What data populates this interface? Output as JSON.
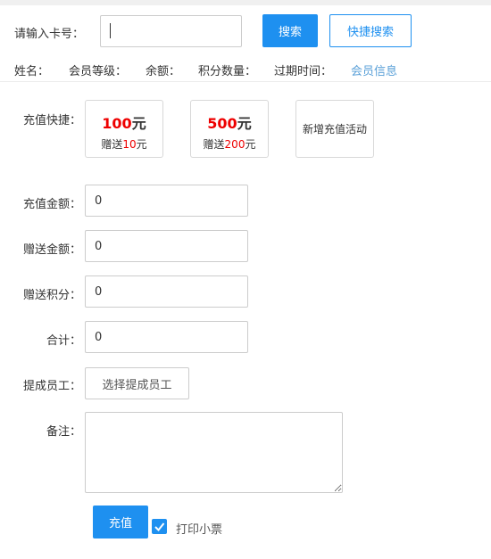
{
  "search": {
    "label": "请输入卡号：",
    "value": "",
    "placeholder": "",
    "search_button": "搜索",
    "quick_search_button": "快捷搜索"
  },
  "member_info": {
    "name_label": "姓名：",
    "level_label": "会员等级：",
    "balance_label": "余额：",
    "points_label": "积分数量：",
    "expiry_label": "过期时间：",
    "info_link": "会员信息"
  },
  "quick_recharge": {
    "label": "充值快捷：",
    "options": [
      {
        "amount": "100",
        "unit": "元",
        "gift_prefix": "赠送",
        "gift_amount": "10",
        "gift_unit": "元"
      },
      {
        "amount": "500",
        "unit": "元",
        "gift_prefix": "赠送",
        "gift_amount": "200",
        "gift_unit": "元"
      }
    ],
    "new_activity": "新增充值活动"
  },
  "form": {
    "recharge_amount_label": "充值金额：",
    "recharge_amount_value": "0",
    "gift_amount_label": "赠送金额：",
    "gift_amount_value": "0",
    "gift_points_label": "赠送积分：",
    "gift_points_value": "0",
    "total_label": "合计：",
    "total_value": "0",
    "staff_label": "提成员工：",
    "staff_button": "选择提成员工",
    "remark_label": "备注：",
    "remark_value": ""
  },
  "footer": {
    "recharge_button": "充值",
    "print_receipt_label": "打印小票",
    "print_receipt_checked": true
  },
  "colors": {
    "primary": "#1e90f0",
    "amount_red": "#e00000",
    "link": "#5aa0d8"
  }
}
